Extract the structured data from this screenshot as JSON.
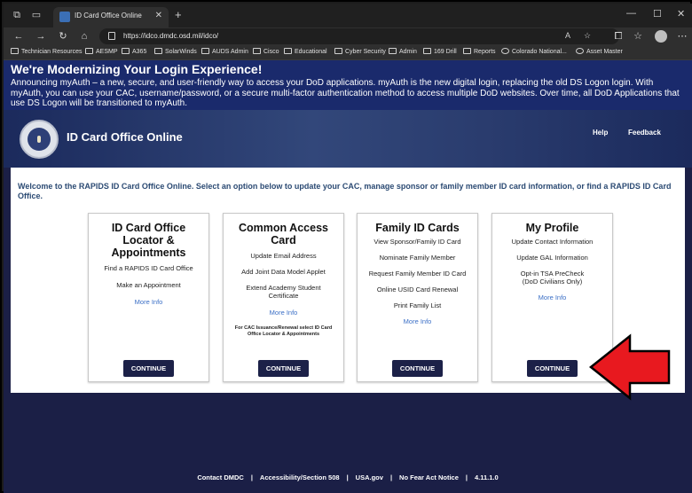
{
  "browser": {
    "tab_title": "ID Card Office Online",
    "url": "https://idco.dmdc.osd.mil/idco/",
    "bookmarks": [
      "Technician Resources",
      "AESMP",
      "A365",
      "SolarWinds",
      "AUDS Admin",
      "Cisco",
      "Educational",
      "Cyber Security",
      "Admin",
      "169 Drill",
      "Reports",
      "Colorado National...",
      "Asset Master"
    ]
  },
  "banner": {
    "title": "We're Modernizing Your Login Experience!",
    "text": "Announcing myAuth – a new, secure, and user-friendly way to access your DoD applications. myAuth is the new digital login, replacing the old DS Logon login. With myAuth, you can use your CAC, username/password, or a secure multi-factor authentication method to access multiple DoD websites.  Over time, all DoD Applications that use DS Logon will be transitioned to myAuth."
  },
  "header": {
    "title": "ID Card Office Online",
    "help": "Help",
    "feedback": "Feedback"
  },
  "welcome": "Welcome to the RAPIDS ID Card Office Online. Select an option below to update your CAC, manage sponsor or family member ID card information, or find a RAPIDS ID Card Office.",
  "cards": [
    {
      "title": "ID Card Office Locator & Appointments",
      "items": [
        "Find a RAPIDS ID Card Office",
        "Make an Appointment"
      ],
      "more": "More Info",
      "button": "CONTINUE"
    },
    {
      "title": "Common Access Card",
      "items": [
        "Update Email Address",
        "Add Joint Data Model Applet",
        "Extend Academy Student Certificate"
      ],
      "more": "More Info",
      "fine": "For CAC Issuance/Renewal select ID Card Office Locator & Appointments",
      "button": "CONTINUE"
    },
    {
      "title": "Family ID Cards",
      "items": [
        "View Sponsor/Family ID Card",
        "Nominate Family Member",
        "Request Family Member ID Card",
        "Online USID Card Renewal",
        "Print Family List"
      ],
      "more": "More Info",
      "button": "CONTINUE"
    },
    {
      "title": "My Profile",
      "items": [
        "Update Contact Information",
        "Update GAL Information",
        "Opt-in TSA PreCheck (DoD Civilians Only)"
      ],
      "more": "More Info",
      "button": "CONTINUE"
    }
  ],
  "footer": {
    "links": [
      "Contact DMDC",
      "|",
      "Accessibility/Section 508",
      "|",
      "USA.gov",
      "|",
      "No Fear Act Notice",
      "|",
      "4.11.1.0"
    ]
  },
  "colors": {
    "banner": "#1a2a6c",
    "page_bg": "#1b1f46",
    "button": "#1c2148",
    "link": "#3b6fc6",
    "arrow": "#e8191f"
  }
}
